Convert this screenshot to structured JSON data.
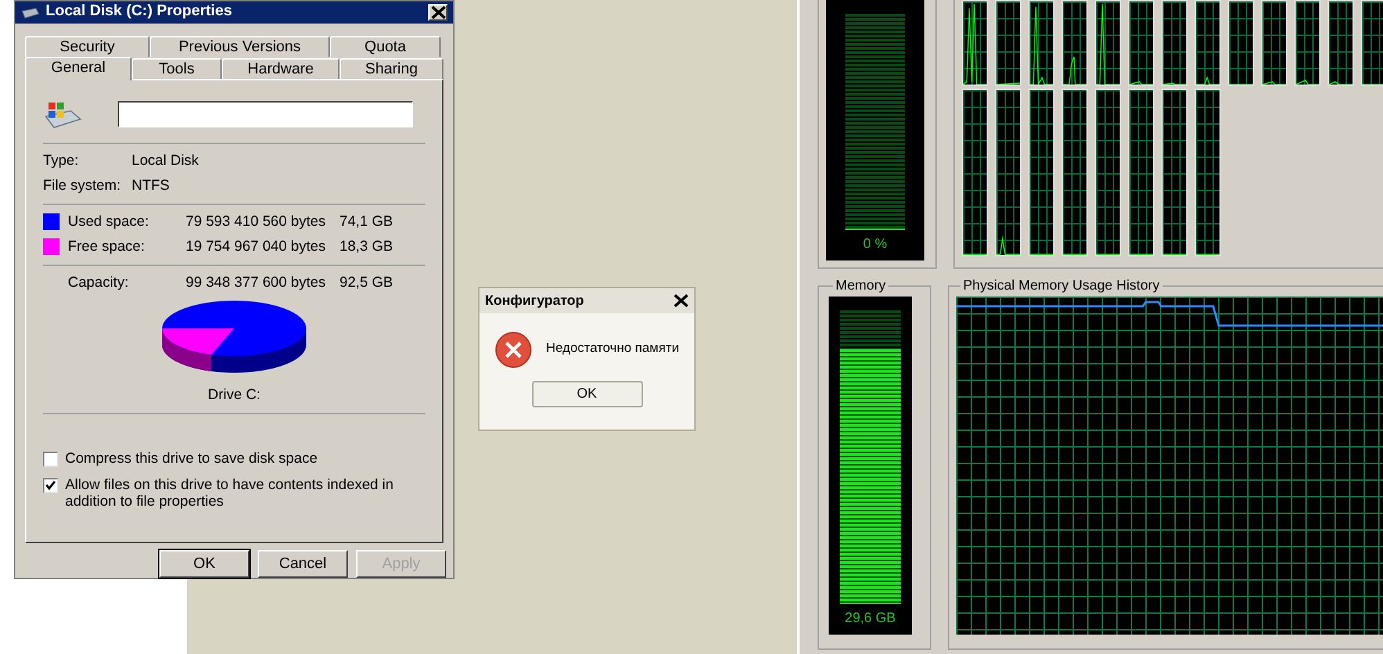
{
  "properties_dialog": {
    "title": "Local Disk (C:) Properties",
    "tab_rows": [
      [
        {
          "label": "Security",
          "selected": false
        },
        {
          "label": "Previous Versions",
          "selected": false
        },
        {
          "label": "Quota",
          "selected": false
        }
      ],
      [
        {
          "label": "General",
          "selected": true
        },
        {
          "label": "Tools",
          "selected": false
        },
        {
          "label": "Hardware",
          "selected": false
        },
        {
          "label": "Sharing",
          "selected": false
        }
      ]
    ],
    "info": [
      {
        "label": "Type:",
        "value": "Local Disk"
      },
      {
        "label": "File system:",
        "value": "NTFS"
      }
    ],
    "space": [
      {
        "label": "Used space:",
        "bytes": "79 593 410 560 bytes",
        "size": "74,1 GB",
        "color": "#0000ff"
      },
      {
        "label": "Free space:",
        "bytes": "19 754 967 040 bytes",
        "size": "18,3 GB",
        "color": "#ff00ff"
      }
    ],
    "capacity": {
      "label": "Capacity:",
      "bytes": "99 348 377 600 bytes",
      "size": "92,5 GB"
    },
    "drive_label": "Drive C:",
    "options": [
      {
        "label": "Compress this drive to save disk space",
        "checked": false
      },
      {
        "label": "Allow files on this drive to have contents indexed in addition to file properties",
        "checked": true
      }
    ],
    "buttons": [
      {
        "label": "OK",
        "disabled": false
      },
      {
        "label": "Cancel",
        "disabled": false
      },
      {
        "label": "Apply",
        "disabled": true
      }
    ]
  },
  "error_dialog": {
    "title": "Конфигуратор",
    "message": "Недостаточно памяти",
    "button": "OK"
  },
  "task_manager": {
    "cpu_meter": {
      "reading": "0 %",
      "level": 0
    },
    "memory_meter": {
      "title": "Memory",
      "reading": "29,6 GB",
      "level": 0.87
    },
    "memory_history": {
      "title": "Physical Memory Usage History"
    }
  }
}
